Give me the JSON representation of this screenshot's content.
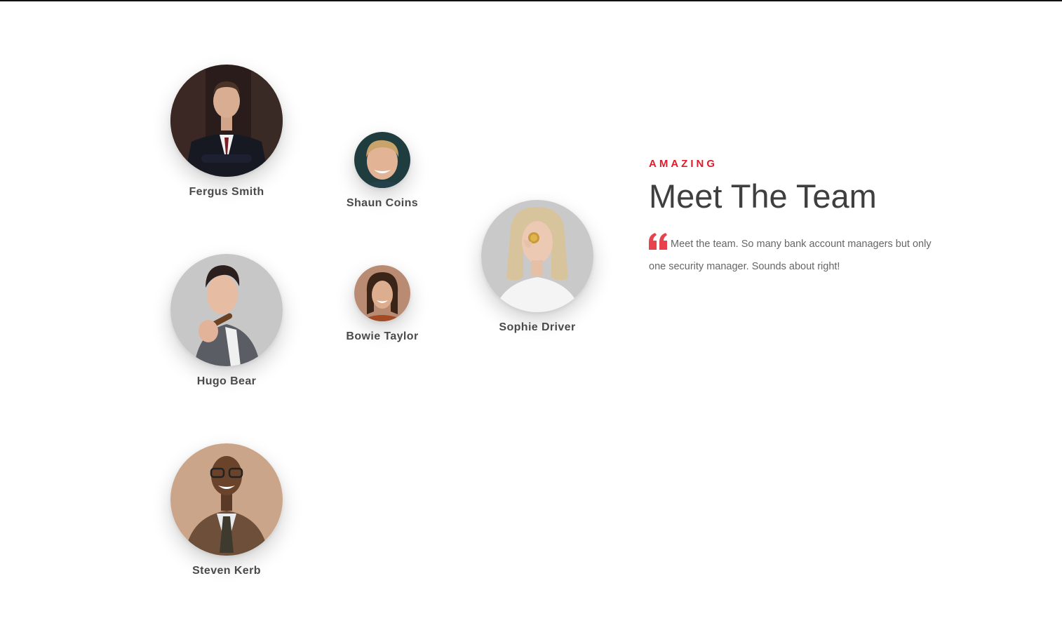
{
  "section": {
    "eyebrow": "AMAZING",
    "title": "Meet The Team",
    "quote": "Meet the team. So many bank account managers but only one security manager. Sounds about right!",
    "quote_icon": "quote-icon"
  },
  "team": [
    {
      "name": "Fergus Smith",
      "photo": "man-in-dark-suit"
    },
    {
      "name": "Shaun Coins",
      "photo": "smiling-blond-man"
    },
    {
      "name": "Sophie Driver",
      "photo": "blonde-woman-holding-coin"
    },
    {
      "name": "Hugo Bear",
      "photo": "man-with-cigar"
    },
    {
      "name": "Bowie Taylor",
      "photo": "smiling-woman"
    },
    {
      "name": "Steven Kerb",
      "photo": "man-with-glasses-and-tie"
    }
  ],
  "colors": {
    "accent": "#e01b2a",
    "heading": "#3f3f3f",
    "body_text": "#666666",
    "names": "#4a4a4a"
  }
}
